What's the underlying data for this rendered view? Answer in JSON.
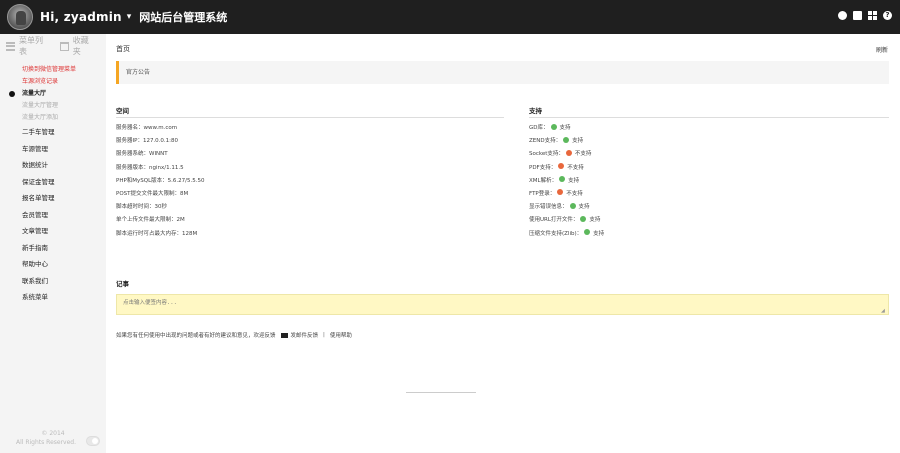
{
  "topbar": {
    "greeting": "Hi, zyadmin",
    "system_title": "网站后台管理系统",
    "icons": [
      "circle-icon",
      "monitor-icon",
      "grid-icon",
      "help-icon"
    ],
    "help_glyph": "?"
  },
  "sidebar": {
    "tabs": [
      {
        "label": "菜单列表",
        "icon": "list-icon"
      },
      {
        "label": "收藏夹",
        "icon": "folder-icon"
      }
    ],
    "menu": [
      {
        "label": "切换到微信管理菜单",
        "style": "red"
      },
      {
        "label": "车源浏览记录",
        "style": "red"
      },
      {
        "label": "流量大厅",
        "style": "hdr"
      },
      {
        "label": "流量大厅管理",
        "style": "sub"
      },
      {
        "label": "流量大厅添加",
        "style": "sub"
      },
      {
        "label": "二手车管理",
        "style": "bold"
      },
      {
        "label": "车源管理",
        "style": "bold"
      },
      {
        "label": "数据统计",
        "style": "bold"
      },
      {
        "label": "保证金管理",
        "style": "bold"
      },
      {
        "label": "报名单管理",
        "style": "bold"
      },
      {
        "label": "会员管理",
        "style": "bold"
      },
      {
        "label": "文章管理",
        "style": "bold"
      },
      {
        "label": "新手指南",
        "style": "bold"
      },
      {
        "label": "帮助中心",
        "style": "bold"
      },
      {
        "label": "联系我们",
        "style": "bold"
      },
      {
        "label": "系统菜单",
        "style": "bold"
      }
    ],
    "footer": {
      "line1": "© 2014",
      "line2": "All Rights Reserved."
    }
  },
  "main": {
    "breadcrumb": "首页",
    "refresh": "刷新",
    "notice": "官方公告",
    "server": {
      "title": "空间",
      "rows": [
        "服务器名：www.m.com",
        "服务器IP：127.0.0.1:80",
        "服务器系统：WINNT",
        "服务器版本：nginx/1.11.5",
        "PHP和MySQL版本：5.6.27/5.5.50",
        "POST提交文件最大限制：8M",
        "脚本超时时间：30秒",
        "单个上传文件最大限制：2M",
        "脚本运行时可占最大内存：128M"
      ]
    },
    "support": {
      "title": "支持",
      "rows": [
        {
          "label": "GD库：",
          "ok": true,
          "status": "支持"
        },
        {
          "label": "ZEND支持：",
          "ok": true,
          "status": "支持"
        },
        {
          "label": "Socket支持：",
          "ok": false,
          "status": "不支持"
        },
        {
          "label": "PDF支持：",
          "ok": false,
          "status": "不支持"
        },
        {
          "label": "XML解析：",
          "ok": true,
          "status": "支持"
        },
        {
          "label": "FTP登录：",
          "ok": false,
          "status": "不支持"
        },
        {
          "label": "显示错误信息：",
          "ok": true,
          "status": "支持"
        },
        {
          "label": "使用URL打开文件：",
          "ok": true,
          "status": "支持"
        },
        {
          "label": "压缩文件支持(Zlib)：",
          "ok": true,
          "status": "支持"
        }
      ],
      "colors": {
        "ok": "#5cb85c",
        "no": "#e8673c"
      }
    },
    "memo": {
      "title": "记事",
      "placeholder": "点击输入便签内容..."
    },
    "footer": {
      "text": "如果您有任何使用中出现的问题或者有好的建议和意见，欢迎反馈",
      "feedback": "发邮件反馈",
      "sep": "|",
      "help": "使用帮助"
    }
  },
  "colors": {
    "topbar": "#1f1f1f",
    "accent": "#f5a623",
    "memo_bg": "#fff8c4"
  }
}
